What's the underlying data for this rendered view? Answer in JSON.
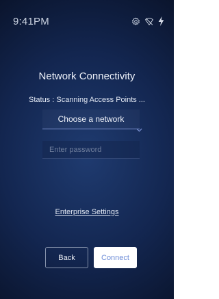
{
  "status_bar": {
    "time": "9:41PM",
    "icons": [
      "settings-gear-icon",
      "wifi-off-icon",
      "charging-bolt-icon"
    ]
  },
  "page": {
    "title": "Network Connectivity",
    "status_label": "Status :",
    "status_value": "Scanning Access Points ..."
  },
  "network_select": {
    "selected": "Choose a network"
  },
  "password_field": {
    "value": "",
    "placeholder": "Enter password"
  },
  "links": {
    "enterprise_settings": "Enterprise Settings"
  },
  "buttons": {
    "back": "Back",
    "connect": "Connect"
  },
  "colors": {
    "background_center": "#1f3b70",
    "background_edge": "#050b18",
    "select_underline": "#7d93d4",
    "connect_text": "#6f8ed8"
  }
}
